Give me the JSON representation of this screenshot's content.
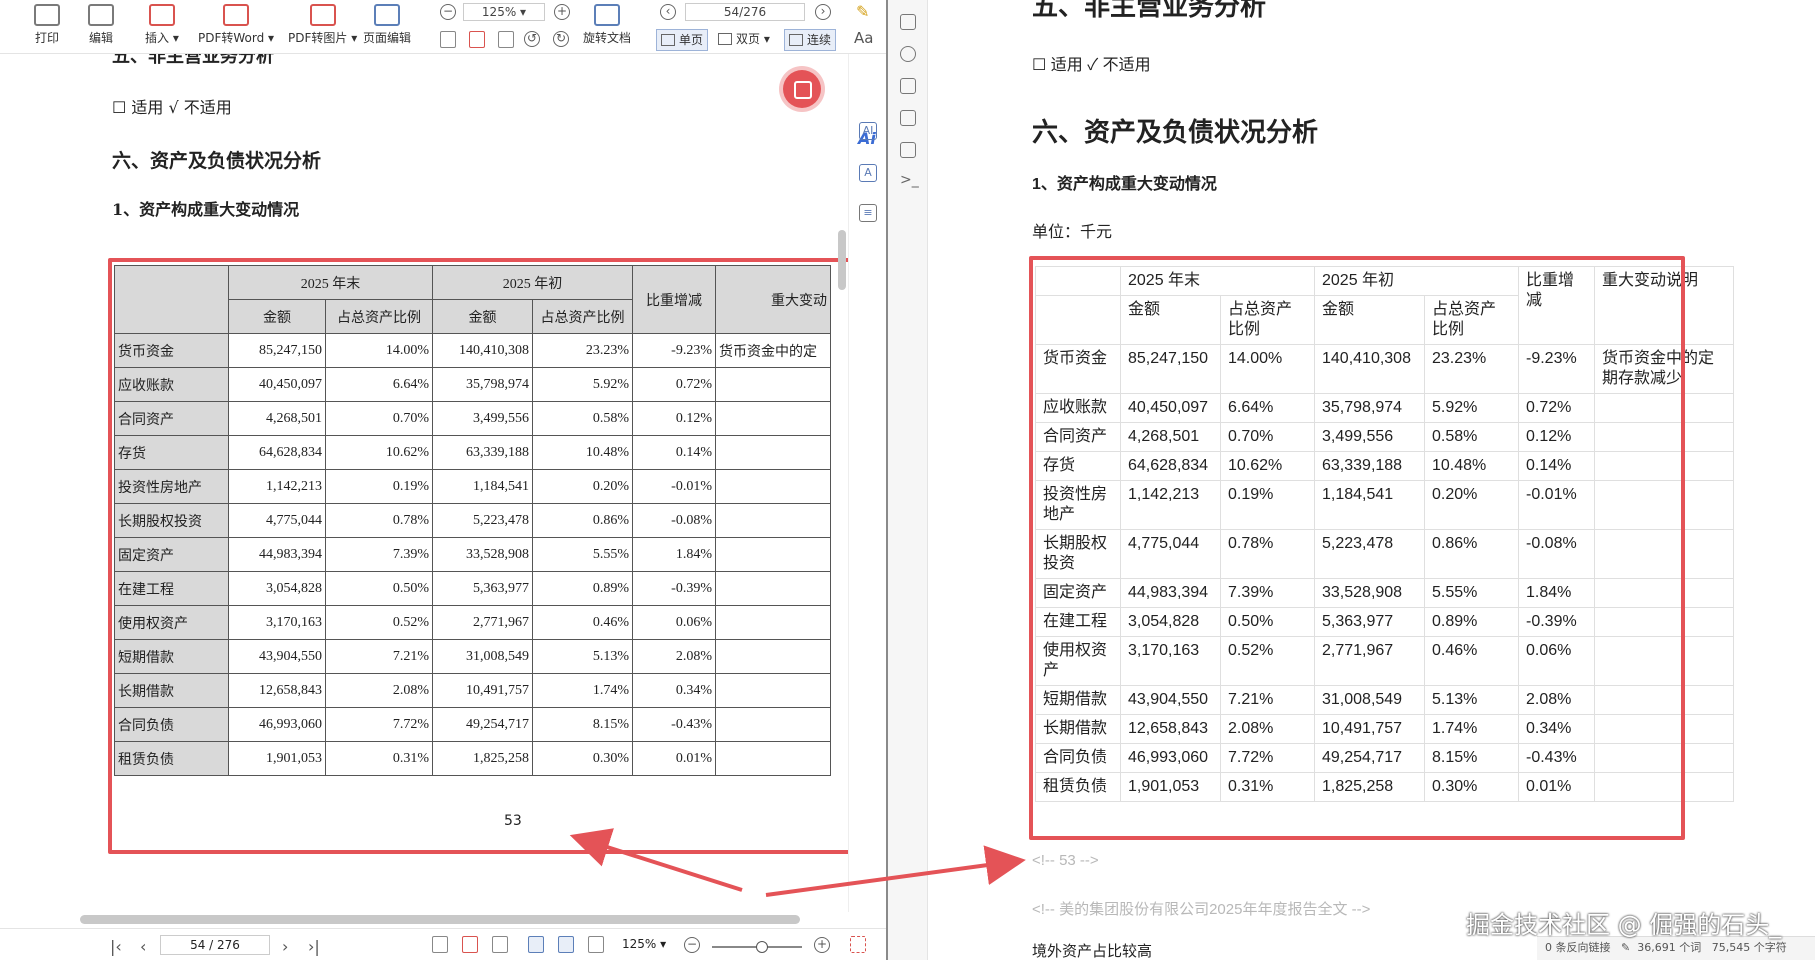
{
  "toolbar": {
    "print": "打印",
    "edit": "编辑",
    "insert": "插入",
    "pdf_to_word": "PDF转Word",
    "pdf_to_image": "PDF转图片",
    "page_edit": "页面编辑",
    "zoom_value": "125%",
    "rotate_doc": "旋转文档",
    "page_value": "54/276",
    "single_page": "单页",
    "double_page": "双页",
    "continuous": "连续"
  },
  "pdf_page": {
    "top_heading_cut": "五、非主营业务分析",
    "applicability": "☐  适用   √  不适用",
    "section_heading": "六、资产及负债状况分析",
    "sub_heading": "1、资产构成重大变动情况",
    "page_number": "53"
  },
  "status_bar": {
    "page_value": "54 / 276",
    "zoom_value": "125%"
  },
  "table": {
    "header_top": [
      "2025 年末",
      "2025 年初",
      "比重增减",
      "重大变动说明"
    ],
    "header_sub": [
      "金额",
      "占总资产比例",
      "金额",
      "占总资产比例"
    ],
    "pdf_note_header": "重大变动",
    "pdf_first_note": "货币资金中的定",
    "rows": [
      {
        "item": "货币资金",
        "end_amount": "85,247,150",
        "end_ratio": "14.00%",
        "begin_amount": "140,410,308",
        "begin_ratio": "23.23%",
        "change": "-9.23%",
        "note": "货币资金中的定期存款减少"
      },
      {
        "item": "应收账款",
        "end_amount": "40,450,097",
        "end_ratio": "6.64%",
        "begin_amount": "35,798,974",
        "begin_ratio": "5.92%",
        "change": "0.72%",
        "note": ""
      },
      {
        "item": "合同资产",
        "end_amount": "4,268,501",
        "end_ratio": "0.70%",
        "begin_amount": "3,499,556",
        "begin_ratio": "0.58%",
        "change": "0.12%",
        "note": ""
      },
      {
        "item": "存货",
        "end_amount": "64,628,834",
        "end_ratio": "10.62%",
        "begin_amount": "63,339,188",
        "begin_ratio": "10.48%",
        "change": "0.14%",
        "note": ""
      },
      {
        "item": "投资性房地产",
        "end_amount": "1,142,213",
        "end_ratio": "0.19%",
        "begin_amount": "1,184,541",
        "begin_ratio": "0.20%",
        "change": "-0.01%",
        "note": ""
      },
      {
        "item": "长期股权投资",
        "end_amount": "4,775,044",
        "end_ratio": "0.78%",
        "begin_amount": "5,223,478",
        "begin_ratio": "0.86%",
        "change": "-0.08%",
        "note": ""
      },
      {
        "item": "固定资产",
        "end_amount": "44,983,394",
        "end_ratio": "7.39%",
        "begin_amount": "33,528,908",
        "begin_ratio": "5.55%",
        "change": "1.84%",
        "note": ""
      },
      {
        "item": "在建工程",
        "end_amount": "3,054,828",
        "end_ratio": "0.50%",
        "begin_amount": "5,363,977",
        "begin_ratio": "0.89%",
        "change": "-0.39%",
        "note": ""
      },
      {
        "item": "使用权资产",
        "end_amount": "3,170,163",
        "end_ratio": "0.52%",
        "begin_amount": "2,771,967",
        "begin_ratio": "0.46%",
        "change": "0.06%",
        "note": ""
      },
      {
        "item": "短期借款",
        "end_amount": "43,904,550",
        "end_ratio": "7.21%",
        "begin_amount": "31,008,549",
        "begin_ratio": "5.13%",
        "change": "2.08%",
        "note": ""
      },
      {
        "item": "长期借款",
        "end_amount": "12,658,843",
        "end_ratio": "2.08%",
        "begin_amount": "10,491,757",
        "begin_ratio": "1.74%",
        "change": "0.34%",
        "note": ""
      },
      {
        "item": "合同负债",
        "end_amount": "46,993,060",
        "end_ratio": "7.72%",
        "begin_amount": "49,254,717",
        "begin_ratio": "8.15%",
        "change": "-0.43%",
        "note": ""
      },
      {
        "item": "租赁负债",
        "end_amount": "1,901,053",
        "end_ratio": "0.31%",
        "begin_amount": "1,825,258",
        "begin_ratio": "0.30%",
        "change": "0.01%",
        "note": ""
      }
    ]
  },
  "md_page": {
    "top_heading_cut": "五、非主营业务分析",
    "applicability": "☐ 适用 ✓ 不适用",
    "section_heading": "六、资产及负债状况分析",
    "sub_heading": "1、资产构成重大变动情况",
    "unit": "单位：千元",
    "comment_page": "<!-- 53 -->",
    "comment_title": "<!-- 美的集团股份有限公司2025年年度报告全文 -->",
    "next_heading": "境外资产占比较高"
  },
  "md_status": {
    "backlinks": "0 条反向链接",
    "words": "36,691 个词",
    "chars": "75,545 个字符"
  },
  "watermark": "掘金技术社区 @ 倔强的石头_",
  "colors": {
    "highlight": "#e45357",
    "header_fill": "#d9d9d9",
    "accent_blue": "#3b6cd4"
  }
}
